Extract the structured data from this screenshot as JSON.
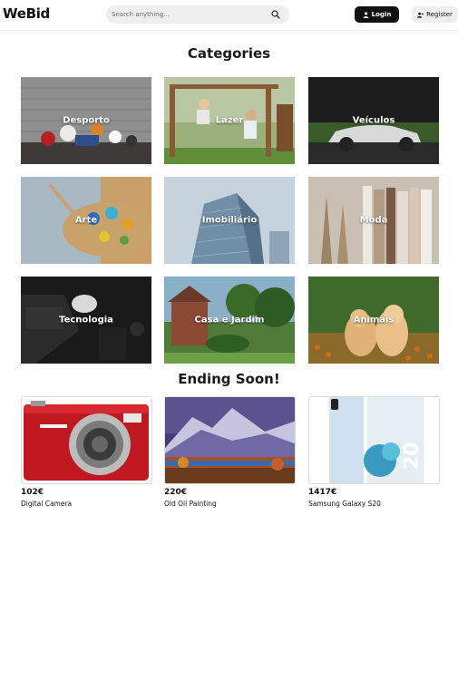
{
  "header": {
    "logo": "WeBid",
    "search": {
      "placeholder": "Search anything..."
    },
    "login_label": "Login",
    "register_label": "Register"
  },
  "categories": {
    "title": "Categories",
    "items": [
      {
        "label": "Desporto"
      },
      {
        "label": "Lazer"
      },
      {
        "label": "Veículos"
      },
      {
        "label": "Arte"
      },
      {
        "label": "Imobiliário"
      },
      {
        "label": "Moda"
      },
      {
        "label": "Tecnologia"
      },
      {
        "label": "Casa e Jardim"
      },
      {
        "label": "Animais"
      }
    ]
  },
  "ending_soon": {
    "title": "Ending Soon!",
    "products": [
      {
        "price": "102€",
        "name": "Digital Camera"
      },
      {
        "price": "220€",
        "name": "Old Oil Painting"
      },
      {
        "price": "1417€",
        "name": "Samsung Galaxy S20"
      }
    ]
  }
}
